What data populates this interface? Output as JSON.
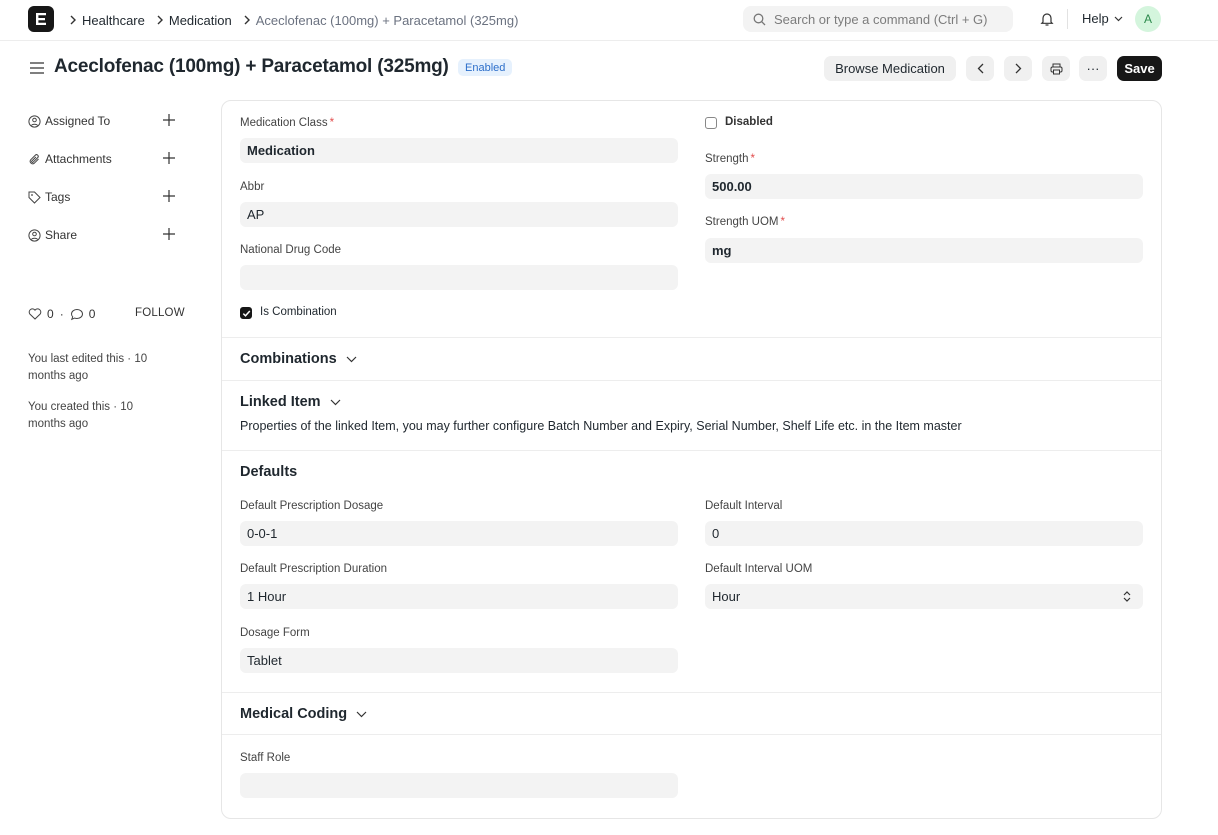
{
  "navbar": {
    "breadcrumbs": [
      "Healthcare",
      "Medication",
      "Aceclofenac (100mg) + Paracetamol (325mg)"
    ],
    "search_placeholder": "Search or type a command (Ctrl + G)",
    "help_label": "Help",
    "avatar_initial": "A"
  },
  "page": {
    "title": "Aceclofenac (100mg) + Paracetamol (325mg)",
    "status_badge": "Enabled",
    "browse_button": "Browse Medication",
    "more_button": "···",
    "save_button": "Save"
  },
  "sidebar": {
    "items": [
      {
        "label": "Assigned To",
        "icon": "assign-icon"
      },
      {
        "label": "Attachments",
        "icon": "paperclip-icon"
      },
      {
        "label": "Tags",
        "icon": "tag-icon"
      },
      {
        "label": "Share",
        "icon": "share-icon"
      }
    ],
    "likes_count": "0",
    "comments_count": "0",
    "follow_label": "FOLLOW",
    "last_edited": "You last edited this · 10 months ago",
    "created": "You created this · 10 months ago"
  },
  "form": {
    "medication_class": {
      "label": "Medication Class",
      "value": "Medication"
    },
    "abbr": {
      "label": "Abbr",
      "value": "AP"
    },
    "national_drug_code": {
      "label": "National Drug Code",
      "value": ""
    },
    "is_combination": {
      "label": "Is Combination",
      "checked": true
    },
    "disabled": {
      "label": "Disabled",
      "checked": false
    },
    "strength": {
      "label": "Strength",
      "value": "500.00"
    },
    "strength_uom": {
      "label": "Strength UOM",
      "value": "mg"
    },
    "required_marker": "*"
  },
  "sections": {
    "combinations": "Combinations",
    "linked_item": "Linked Item",
    "linked_item_description": "Properties of the linked Item, you may further configure Batch Number and Expiry, Serial Number, Shelf Life etc. in the Item master",
    "defaults": "Defaults",
    "medical_coding": "Medical Coding"
  },
  "defaults": {
    "prescription_dosage": {
      "label": "Default Prescription Dosage",
      "value": "0-0-1"
    },
    "prescription_duration": {
      "label": "Default Prescription Duration",
      "value": "1 Hour"
    },
    "dosage_form": {
      "label": "Dosage Form",
      "value": "Tablet"
    },
    "interval": {
      "label": "Default Interval",
      "value": "0"
    },
    "interval_uom": {
      "label": "Default Interval UOM",
      "value": "Hour"
    }
  },
  "coding": {
    "staff_role": {
      "label": "Staff Role",
      "value": ""
    }
  }
}
